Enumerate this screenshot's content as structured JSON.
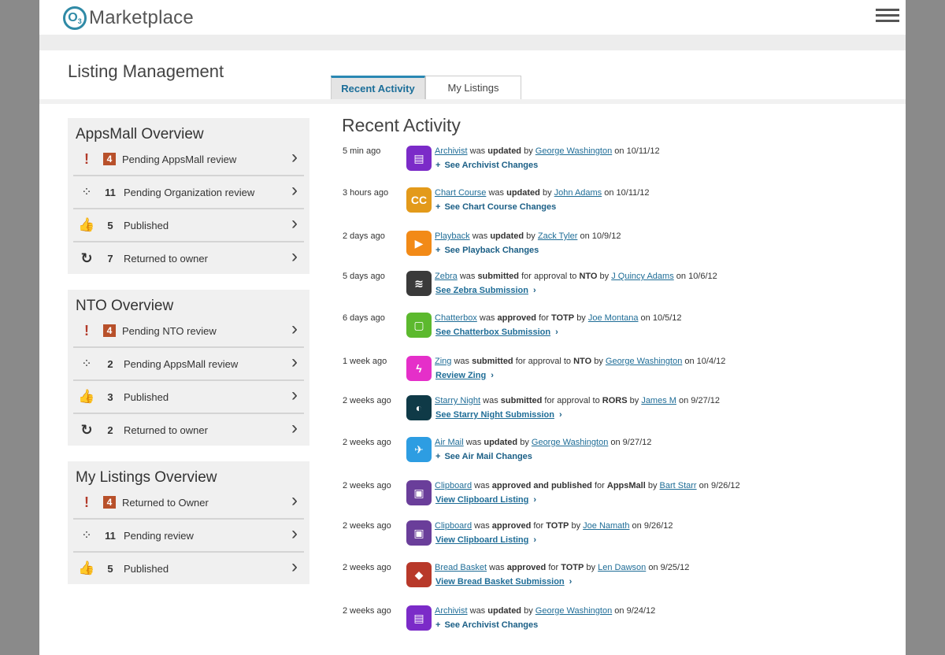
{
  "header": {
    "logo_mark": "O",
    "logo_sub": "3",
    "logo_text": "Marketplace"
  },
  "page_title": "Listing Management",
  "tabs": [
    {
      "label": "Recent Activity"
    },
    {
      "label": "My Listings"
    }
  ],
  "panels": [
    {
      "title": "AppsMall Overview",
      "rows": [
        {
          "icon": "exclamation-icon",
          "count": "4",
          "label": "Pending AppsMall review"
        },
        {
          "icon": "spinner-icon",
          "count": "11",
          "label": "Pending Organization review"
        },
        {
          "icon": "thumbs-up-icon",
          "count": "5",
          "label": "Published"
        },
        {
          "icon": "refresh-icon",
          "count": "7",
          "label": "Returned to owner"
        }
      ]
    },
    {
      "title": "NTO Overview",
      "rows": [
        {
          "icon": "exclamation-icon",
          "count": "4",
          "label": "Pending NTO review"
        },
        {
          "icon": "spinner-icon",
          "count": "2",
          "label": "Pending AppsMall review"
        },
        {
          "icon": "thumbs-up-icon",
          "count": "3",
          "label": "Published"
        },
        {
          "icon": "refresh-icon",
          "count": "2",
          "label": "Returned to owner"
        }
      ]
    },
    {
      "title": "My Listings Overview",
      "rows": [
        {
          "icon": "exclamation-icon",
          "count": "4",
          "label": "Returned to Owner"
        },
        {
          "icon": "spinner-icon",
          "count": "11",
          "label": "Pending review"
        },
        {
          "icon": "thumbs-up-icon",
          "count": "5",
          "label": "Published"
        }
      ]
    }
  ],
  "recent_activity": {
    "title": "Recent Activity",
    "items": [
      {
        "time": "5 min ago",
        "app": "Archivist",
        "icon": "notebook-icon",
        "icon_color": "#7b2bc8",
        "icon_text": "▤",
        "verb": "was",
        "action": "updated",
        "by": "by",
        "user": "George Washington",
        "for": "",
        "target": "",
        "date": "on 10/11/12",
        "link_text": "See Archivist Changes",
        "link_style": "plus"
      },
      {
        "time": "3 hours ago",
        "app": "Chart Course",
        "icon": "cc-icon",
        "icon_color": "#e39a1a",
        "icon_text": "CC",
        "verb": "was",
        "action": "updated",
        "by": "by",
        "user": "John Adams",
        "for": "",
        "target": "",
        "date": "on 10/11/12",
        "link_text": "See Chart Course Changes",
        "link_style": "plus"
      },
      {
        "time": "2 days ago",
        "app": "Playback",
        "icon": "video-icon",
        "icon_color": "#f28a17",
        "icon_text": "▶",
        "verb": "was",
        "action": "updated",
        "by": "by",
        "user": "Zack Tyler",
        "for": "",
        "target": "",
        "date": "on 10/9/12",
        "link_text": "See Playback Changes",
        "link_style": "plus"
      },
      {
        "time": "5 days ago",
        "app": "Zebra",
        "icon": "zebra-icon",
        "icon_color": "#3a3a3a",
        "icon_text": "≋",
        "verb": "was",
        "action": "submitted",
        "by": "by",
        "user": "J Quincy Adams",
        "for": "for approval to",
        "target": "NTO",
        "date": "on 10/6/12",
        "link_text": "See Zebra Submission",
        "link_style": "chev"
      },
      {
        "time": "6 days ago",
        "app": "Chatterbox",
        "icon": "chat-icon",
        "icon_color": "#5cb92e",
        "icon_text": "▢",
        "verb": "was",
        "action": "approved",
        "by": "by",
        "user": "Joe Montana",
        "for": "for",
        "target": "TOTP",
        "date": "on 10/5/12",
        "link_text": "See Chatterbox Submission",
        "link_style": "chev"
      },
      {
        "time": "1 week ago",
        "app": "Zing",
        "icon": "lightning-icon",
        "icon_color": "#e52fc9",
        "icon_text": "ϟ",
        "verb": "was",
        "action": "submitted",
        "by": "by",
        "user": "George Washington",
        "for": "for approval to",
        "target": "NTO",
        "date": "on 10/4/12",
        "link_text": "Review Zing",
        "link_style": "chev"
      },
      {
        "time": "2 weeks ago",
        "app": "Starry Night",
        "icon": "moon-icon",
        "icon_color": "#0f3a47",
        "icon_text": "◐",
        "verb": "was",
        "action": "submitted",
        "by": "by",
        "user": "James M",
        "for": "for approval to",
        "target": "RORS",
        "date": "on 9/27/12",
        "link_text": "See Starry Night Submission",
        "link_style": "chev"
      },
      {
        "time": "2 weeks ago",
        "app": "Air Mail",
        "icon": "paper-plane-icon",
        "icon_color": "#2d9de2",
        "icon_text": "✈",
        "verb": "was",
        "action": "updated",
        "by": "by",
        "user": "George Washington",
        "for": "",
        "target": "",
        "date": "on 9/27/12",
        "link_text": "See Air Mail Changes",
        "link_style": "plus"
      },
      {
        "time": "2 weeks ago",
        "app": "Clipboard",
        "icon": "clipboard-icon",
        "icon_color": "#6a3e9a",
        "icon_text": "▣",
        "verb": "was",
        "action": "approved and published",
        "by": "by",
        "user": "Bart Starr",
        "for": "for",
        "target": "AppsMall",
        "date": "on 9/26/12",
        "link_text": "View Clipboard Listing",
        "link_style": "chev"
      },
      {
        "time": "2 weeks ago",
        "app": "Clipboard",
        "icon": "clipboard-icon",
        "icon_color": "#6a3e9a",
        "icon_text": "▣",
        "verb": "was",
        "action": "approved",
        "by": "by",
        "user": "Joe Namath",
        "for": "for",
        "target": "TOTP",
        "date": "on 9/26/12",
        "link_text": "View Clipboard Listing",
        "link_style": "chev"
      },
      {
        "time": "2 weeks ago",
        "app": "Bread Basket",
        "icon": "football-icon",
        "icon_color": "#b8392a",
        "icon_text": "◆",
        "verb": "was",
        "action": "approved",
        "by": "by",
        "user": "Len Dawson",
        "for": "for",
        "target": "TOTP",
        "date": "on 9/25/12",
        "link_text": "View Bread Basket Submission",
        "link_style": "chev"
      },
      {
        "time": "2 weeks ago",
        "app": "Archivist",
        "icon": "notebook-icon",
        "icon_color": "#7b2bc8",
        "icon_text": "▤",
        "verb": "was",
        "action": "updated",
        "by": "by",
        "user": "George Washington",
        "for": "",
        "target": "",
        "date": "on 9/24/12",
        "link_text": "See Archivist Changes",
        "link_style": "plus"
      }
    ]
  },
  "colors": {
    "accent": "#2a88b3",
    "badge": "#b8502a",
    "link": "#1f6d97"
  }
}
